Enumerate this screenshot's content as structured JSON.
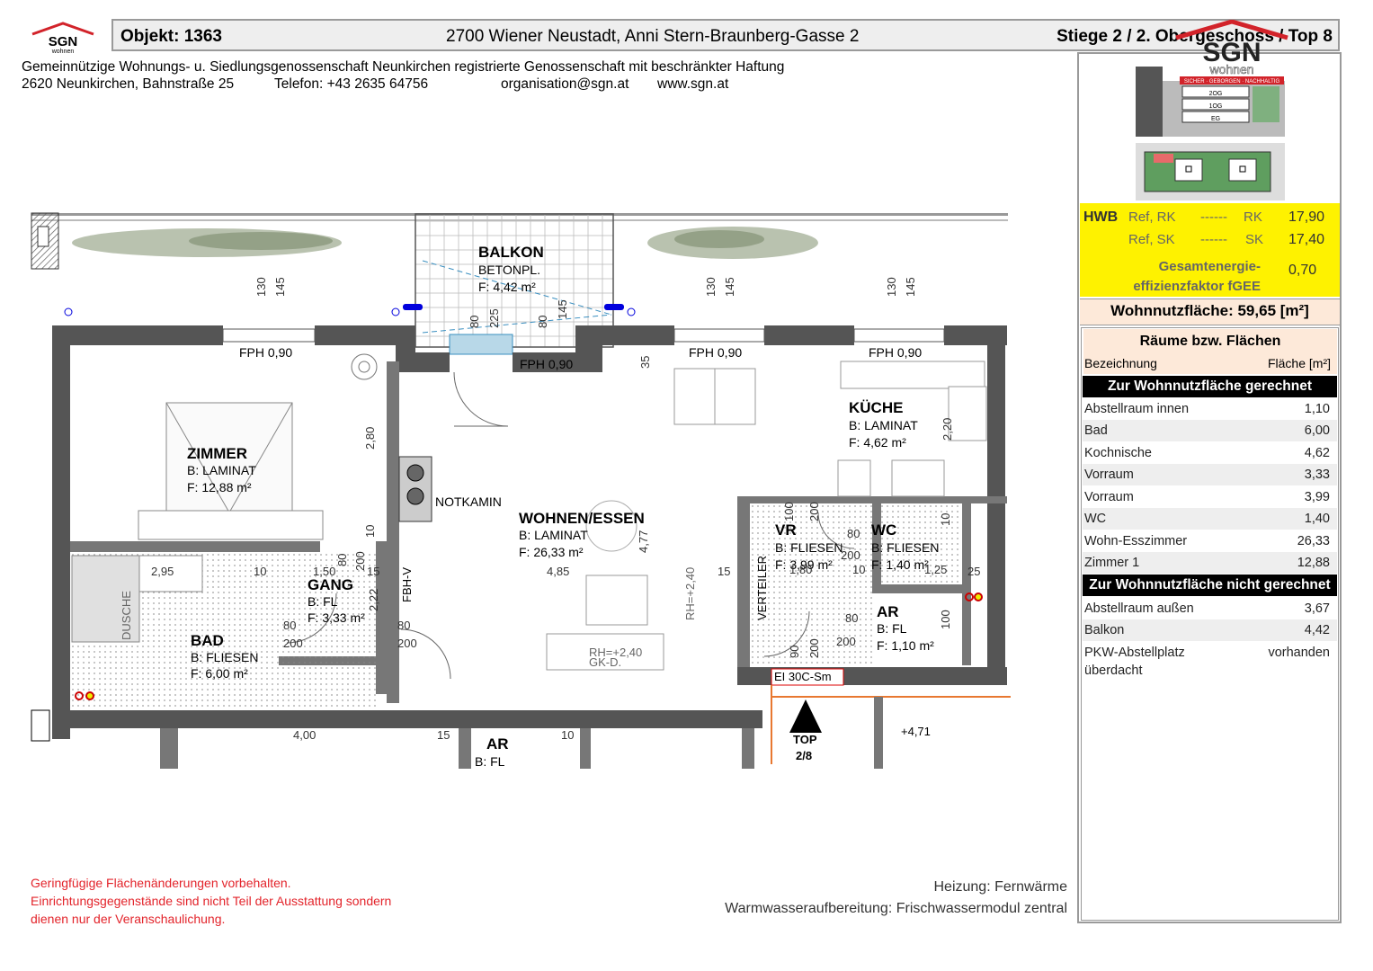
{
  "header": {
    "logo_text": "SGN",
    "logo_sub": "wohnen",
    "objekt_label": "Objekt:  1363",
    "address": "2700 Wiener Neustadt, Anni Stern-Braunberg-Gasse 2",
    "stiege": "Stiege 2 / 2. Obergeschoss / Top 8",
    "coop_name": "Gemeinnützige Wohnungs- u. Siedlungsgenossenschaft Neunkirchen registrierte Genossenschaft mit beschränkter Haftung",
    "coop_street": "2620 Neunkirchen, Bahnstraße 25",
    "coop_phone": "Telefon: +43 2635 64756",
    "coop_email": "organisation@sgn.at",
    "coop_web": "www.sgn.at"
  },
  "logo_big": {
    "text": "SGN",
    "sub": "wohnen",
    "tagline": "SICHER · GEBORGEN · NACHHALTIG"
  },
  "thumb": {
    "floor_2og": "2OG",
    "floor_1og": "1OG",
    "floor_eg": "EG"
  },
  "hwb": {
    "label": "HWB",
    "ref_rk": "Ref, RK",
    "ref_sk": "Ref, SK",
    "dashes": "------",
    "rk": "RK",
    "sk": "SK",
    "rk_value": "17,90",
    "sk_value": "17,40",
    "fgee_label_1": "Gesamtenergie-",
    "fgee_label_2": "effizienzfaktor fGEE",
    "fgee_value": "0,70"
  },
  "wohnnutzflaeche": "Wohnnutzfläche: 59,65 [m²]",
  "rooms": {
    "title": "Räume bzw. Flächen",
    "col_name": "Bezeichnung",
    "col_area": "Fläche [m²]",
    "section_included": "Zur Wohnnutzfläche gerechnet",
    "included": [
      {
        "name": "Abstellraum innen",
        "area": "1,10"
      },
      {
        "name": "Bad",
        "area": "6,00"
      },
      {
        "name": "Kochnische",
        "area": "4,62"
      },
      {
        "name": "Vorraum",
        "area": "3,33"
      },
      {
        "name": "Vorraum",
        "area": "3,99"
      },
      {
        "name": "WC",
        "area": "1,40"
      },
      {
        "name": "Wohn-Esszimmer",
        "area": "26,33"
      },
      {
        "name": "Zimmer 1",
        "area": "12,88"
      }
    ],
    "section_excluded": "Zur Wohnnutzfläche nicht gerechnet",
    "excluded": [
      {
        "name": "Abstellraum außen",
        "area": "3,67"
      },
      {
        "name": "Balkon",
        "area": "4,42"
      }
    ],
    "pkw_name_1": "PKW-Abstellplatz",
    "pkw_name_2": "überdacht",
    "pkw_value": "vorhanden"
  },
  "footer": {
    "disclaimer_1": "Geringfügige Flächenänderungen vorbehalten.",
    "disclaimer_2": "Einrichtungsgegenstände sind nicht Teil der Ausstattung sondern",
    "disclaimer_3": "dienen nur der Veranschaulichung.",
    "heizung": "Heizung: Fernwärme",
    "warmwasser": "Warmwasseraufbereitung: Frischwassermodul zentral"
  },
  "plan": {
    "balkon": {
      "name": "BALKON",
      "floor": "BETONPL.",
      "area": "F: 4,42 m²"
    },
    "zimmer": {
      "name": "ZIMMER",
      "floor": "B: LAMINAT",
      "area": "F: 12,88 m²"
    },
    "wohnen": {
      "name": "WOHNEN/ESSEN",
      "floor": "B: LAMINAT",
      "area": "F: 26,33 m²"
    },
    "kueche": {
      "name": "KÜCHE",
      "floor": "B: LAMINAT",
      "area": "F: 4,62 m²"
    },
    "bad": {
      "name": "BAD",
      "floor": "B: FLIESEN",
      "area": "F: 6,00 m²"
    },
    "gang": {
      "name": "GANG",
      "floor": "B: FL",
      "area": "F: 3,33 m²"
    },
    "vr": {
      "name": "VR",
      "floor": "B: FLIESEN",
      "area": "F: 3,99 m²"
    },
    "wc": {
      "name": "WC",
      "floor": "B: FLIESEN",
      "area": "F: 1,40 m²"
    },
    "ar": {
      "name": "AR",
      "floor": "B: FL",
      "area": "F: 1,10 m²"
    },
    "ar_lower": {
      "name": "AR",
      "floor": "B: FL"
    },
    "notkamin": "NOTKAMIN",
    "fph": "FPH 0,90",
    "fbh": "FBH-V",
    "dusche": "DUSCHE",
    "verteiler": "VERTEILER",
    "gkd_1": "GK-D.",
    "gkd_rh": "RH=+2,40",
    "ei30": "EI 30C-Sm",
    "top_label_1": "TOP",
    "top_label_2": "2/8",
    "level": "+4,71",
    "dims": {
      "d130": "130",
      "d145": "145",
      "d80": "80",
      "d225": "225",
      "d35": "35",
      "d280": "2,80",
      "d220": "2,20",
      "d10": "10",
      "d295": "2,95",
      "d150": "1,50",
      "d200": "200",
      "d15": "15",
      "d222": "2,22",
      "d485": "4,85",
      "d477": "4,77",
      "d180": "1,80",
      "d100": "100",
      "d125": "1,25",
      "d25": "25",
      "d90": "90",
      "d400": "4,00"
    }
  }
}
